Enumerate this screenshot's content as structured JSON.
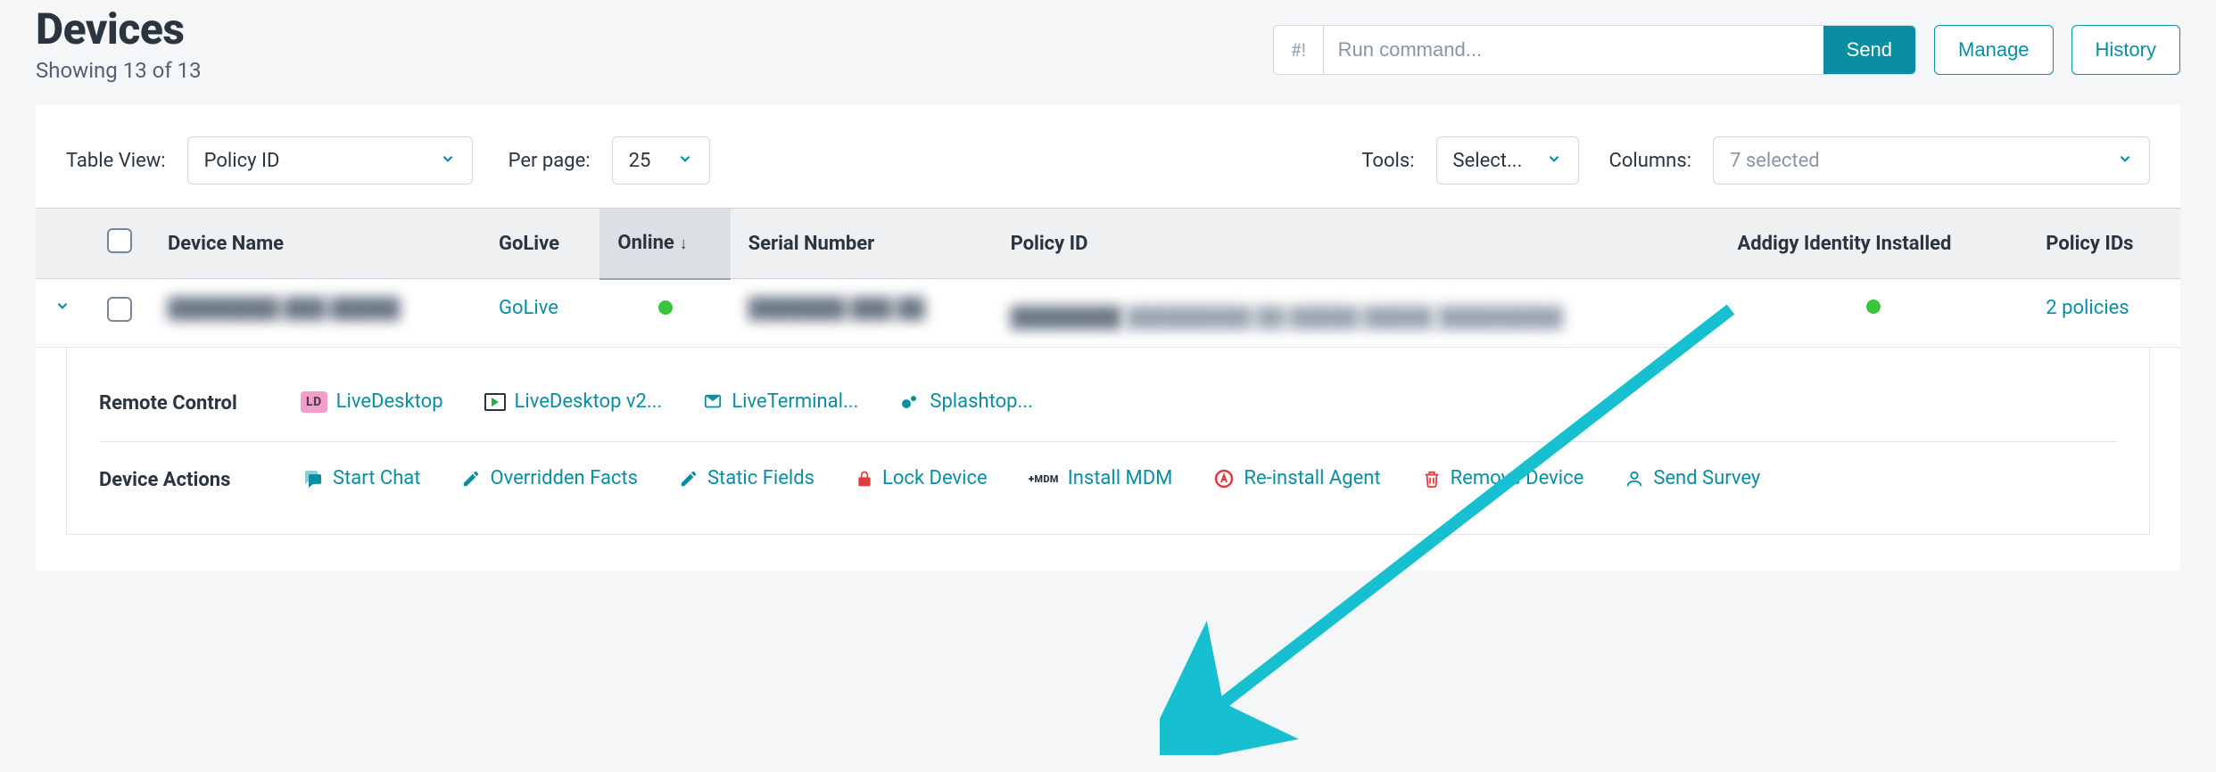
{
  "header": {
    "title": "Devices",
    "subtitle": "Showing 13 of 13",
    "command_prefix": "#!",
    "command_placeholder": "Run command...",
    "send_label": "Send",
    "manage_label": "Manage",
    "history_label": "History"
  },
  "controls": {
    "table_view_label": "Table View:",
    "table_view_value": "Policy ID",
    "per_page_label": "Per page:",
    "per_page_value": "25",
    "tools_label": "Tools:",
    "tools_value": "Select...",
    "columns_label": "Columns:",
    "columns_value": "7 selected"
  },
  "table": {
    "columns": {
      "device_name": "Device Name",
      "golive": "GoLive",
      "online": "Online",
      "serial_number": "Serial Number",
      "policy_id": "Policy ID",
      "addigy_identity": "Addigy Identity Installed",
      "policy_ids": "Policy IDs"
    },
    "row": {
      "device_name": "████████ ███ █████",
      "golive": "GoLive",
      "serial_number": "███████ ███ ██",
      "policy_id_line1": "████████",
      "policy_id_line2": "█████████ ██ █████ █████",
      "policy_id_line3": "█████████",
      "policy_ids": "2 policies"
    }
  },
  "panel": {
    "remote_control_label": "Remote Control",
    "remote": {
      "livedesktop": "LiveDesktop",
      "livedesktop2": "LiveDesktop v2...",
      "liveterminal": "LiveTerminal...",
      "splashtop": "Splashtop..."
    },
    "device_actions_label": "Device Actions",
    "actions": {
      "start_chat": "Start Chat",
      "overridden_facts": "Overridden Facts",
      "static_fields": "Static Fields",
      "lock_device": "Lock Device",
      "install_mdm": "Install MDM",
      "reinstall_agent": "Re-install Agent",
      "remove_device": "Remove Device",
      "send_survey": "Send Survey"
    }
  }
}
